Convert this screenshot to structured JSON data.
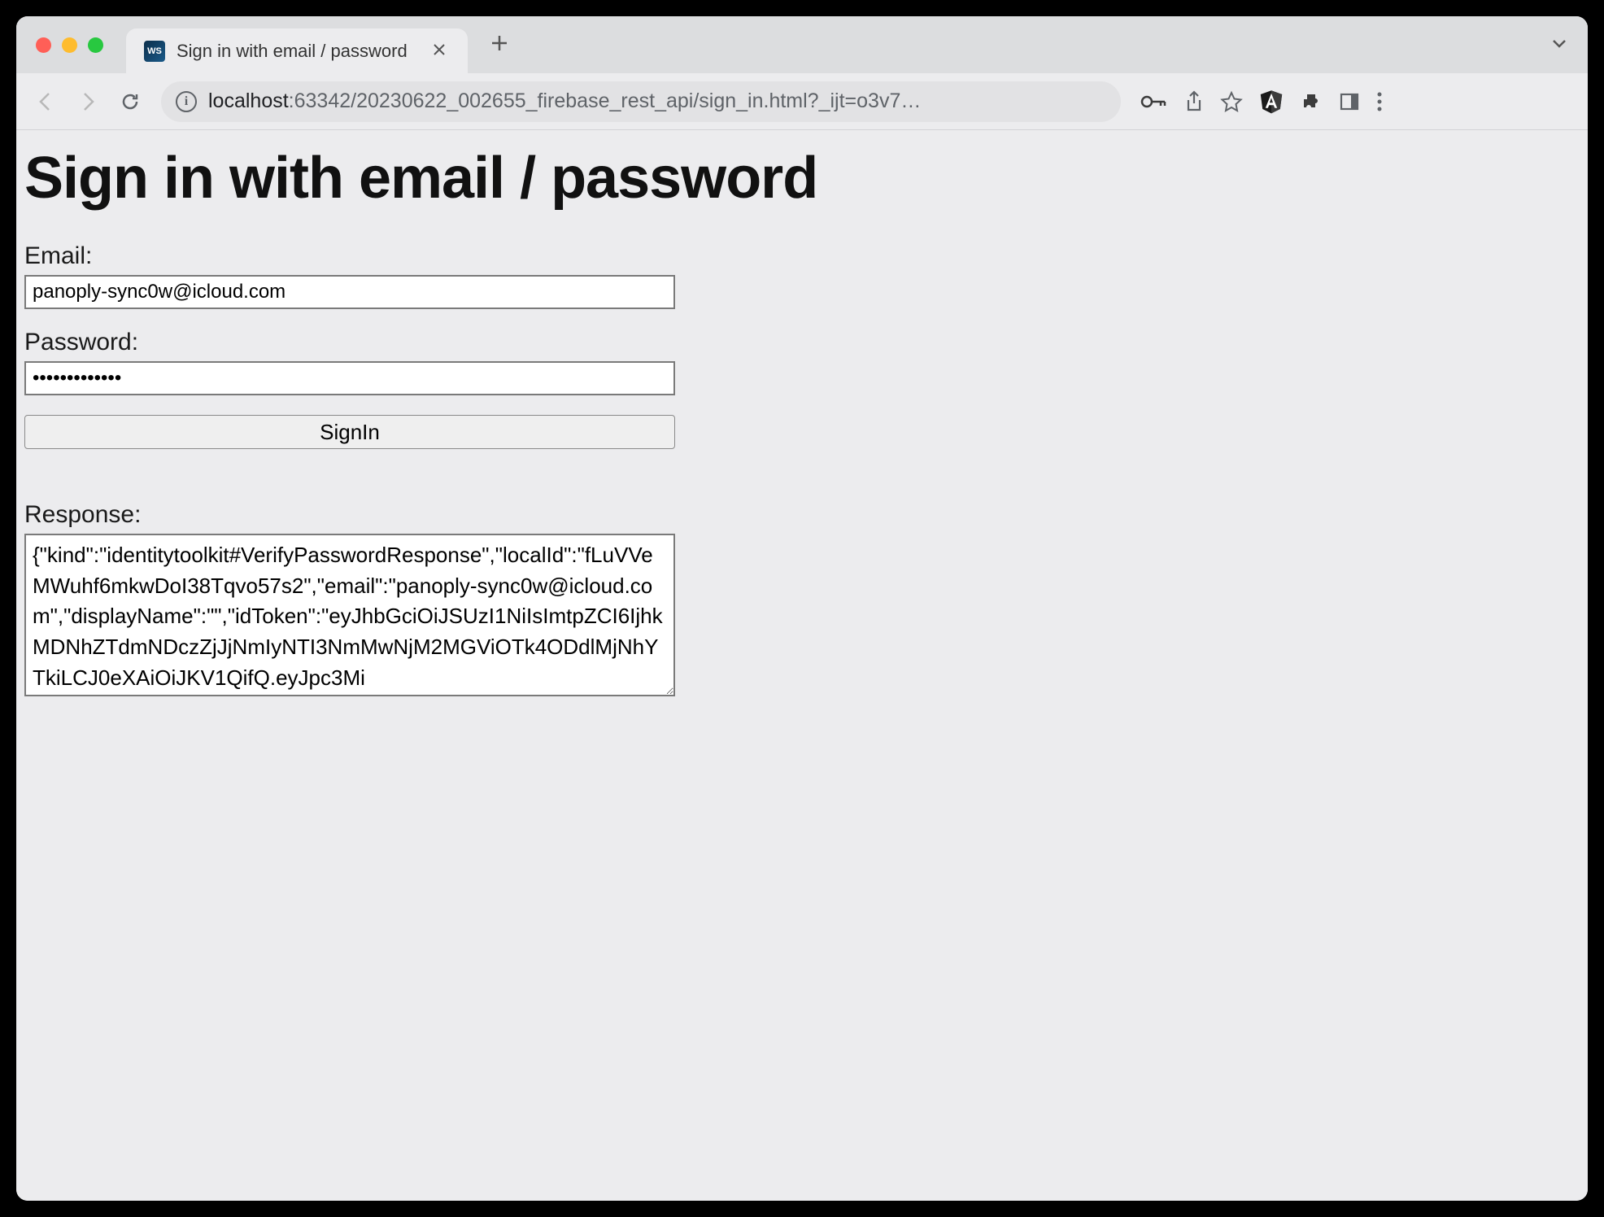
{
  "browser": {
    "tab": {
      "title": "Sign in with email / password",
      "favicon_label": "WS"
    },
    "url_host": "localhost",
    "url_rest": ":63342/20230622_002655_firebase_rest_api/sign_in.html?_ijt=o3v7…"
  },
  "page": {
    "heading": "Sign in with email / password",
    "email_label": "Email:",
    "email_value": "panoply-sync0w@icloud.com",
    "password_label": "Password:",
    "password_value": "•••••••••••••",
    "submit_label": "SignIn",
    "response_label": "Response:",
    "response_value": "{\"kind\":\"identitytoolkit#VerifyPasswordResponse\",\"localId\":\"fLuVVeMWuhf6mkwDoI38Tqvo57s2\",\"email\":\"panoply-sync0w@icloud.com\",\"displayName\":\"\",\"idToken\":\"eyJhbGciOiJSUzI1NiIsImtpZCI6IjhkMDNhZTdmNDczZjJjNmIyNTI3NmMwNjM2MGViOTk4ODdlMjNhYTkiLCJ0eXAiOiJKV1QifQ.eyJpc3Mi"
  }
}
